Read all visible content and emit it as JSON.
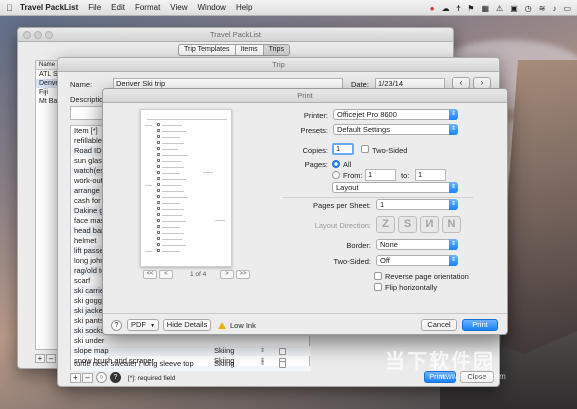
{
  "menubar": {
    "app_name": "Travel PackList",
    "menus": [
      "File",
      "Edit",
      "Format",
      "View",
      "Window",
      "Help"
    ]
  },
  "main_window": {
    "title": "Travel PackList",
    "tabs": [
      "Trip Templates",
      "Items",
      "Trips"
    ],
    "active_tab": "Trips",
    "list_header": "Name [*]",
    "trips": [
      "ATL Sep",
      "Denver",
      "Fiji",
      "Mt Bald"
    ],
    "footer_buttons": [
      "+",
      "–"
    ]
  },
  "trip_window": {
    "title": "Trip",
    "name_label": "Name:",
    "name_value": "Denver Ski trip",
    "date_label": "Date:",
    "date_value": "1/23/14",
    "description_label": "Description:",
    "items_header": "Item [*]",
    "items": [
      {
        "name": "refillable water bottle",
        "category": ""
      },
      {
        "name": "Road ID",
        "category": ""
      },
      {
        "name": "sun glasses",
        "category": ""
      },
      {
        "name": "watch(es)",
        "category": ""
      },
      {
        "name": "work-out",
        "category": ""
      },
      {
        "name": "arrange n",
        "category": ""
      },
      {
        "name": "cash for t",
        "category": ""
      },
      {
        "name": "Dakine gl",
        "category": ""
      },
      {
        "name": "face mask",
        "category": ""
      },
      {
        "name": "head ban",
        "category": ""
      },
      {
        "name": "helmet",
        "category": ""
      },
      {
        "name": "lift passe",
        "category": ""
      },
      {
        "name": "long john",
        "category": ""
      },
      {
        "name": "rag/old to",
        "category": ""
      },
      {
        "name": "scarf",
        "category": ""
      },
      {
        "name": "ski carrie",
        "category": ""
      },
      {
        "name": "ski goggle",
        "category": ""
      },
      {
        "name": "ski jacket",
        "category": ""
      },
      {
        "name": "ski pants",
        "category": ""
      },
      {
        "name": "ski socks",
        "category": ""
      },
      {
        "name": "ski under",
        "category": ""
      },
      {
        "name": "slope map",
        "category": "Skiing"
      },
      {
        "name": "snow brush and scraper",
        "category": "Skiing"
      },
      {
        "name": "turtle neck sweater / long sleeve top",
        "category": "Skiing"
      }
    ],
    "required_note": "[*]: required field",
    "print_button": "Print...",
    "close_button": "Close",
    "footer_buttons": [
      "+",
      "–"
    ]
  },
  "print_dialog": {
    "title": "Print",
    "printer_label": "Printer:",
    "printer_value": "Officejet Pro 8600",
    "presets_label": "Presets:",
    "presets_value": "Default Settings",
    "copies_label": "Copies:",
    "copies_value": "1",
    "two_sided_label": "Two-Sided",
    "pages_label": "Pages:",
    "pages_all": "All",
    "pages_from": "From:",
    "pages_from_value": "1",
    "pages_to": "to:",
    "pages_to_value": "1",
    "section_value": "Layout",
    "pages_per_sheet_label": "Pages per Sheet:",
    "pages_per_sheet_value": "1",
    "layout_direction_label": "Layout Direction:",
    "border_label": "Border:",
    "border_value": "None",
    "two_sided_select_label": "Two-Sided:",
    "two_sided_value": "Off",
    "reverse_label": "Reverse page orientation",
    "flip_label": "Flip horizontally",
    "page_indicator": "1 of 4",
    "nav_first": "<<",
    "nav_prev": "<",
    "nav_next": ">",
    "nav_last": ">>",
    "help": "?",
    "pdf_button": "PDF",
    "hide_details_button": "Hide Details",
    "low_ink": "Low Ink",
    "cancel_button": "Cancel",
    "print_button": "Print"
  },
  "watermark": {
    "text": "当下软件园",
    "url": "www.downxia.com"
  },
  "colors": {
    "accent": "#1a82fb",
    "window_bg": "#ececec",
    "warning": "#e8b400"
  }
}
